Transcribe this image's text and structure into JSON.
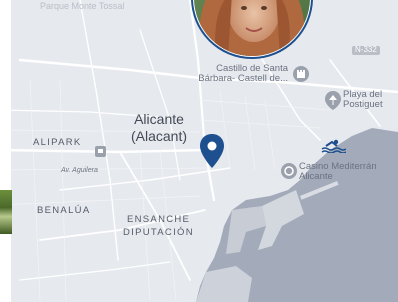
{
  "map": {
    "city": {
      "name": "Alicante",
      "local_name": "(Alacant)"
    },
    "districts": [
      "ALIPARK",
      "BENALÚA",
      "ENSANCHE",
      "DIPUTACIÓN"
    ],
    "streets": [
      "Av. Aguilera"
    ],
    "top_label": "Parque Monte Tossal",
    "highway_badge": "N-332",
    "pois": {
      "castle": {
        "line1": "Castillo de Santa",
        "line2": "Bárbara- Castell de..."
      },
      "beach": {
        "line1": "Playa del",
        "line2": "Postiguet"
      },
      "casino": {
        "line1": "Casino Mediterrán",
        "line2": "Alicante"
      }
    },
    "colors": {
      "land": "#e6e9ee",
      "water": "#a3abba",
      "pin": "#1e4f8f",
      "avatar_ring": "#1e4f8f"
    },
    "icons": {
      "location_pin": "location-pin-icon",
      "castle": "landmark-icon",
      "beach": "beach-icon",
      "swim": "swimming-icon",
      "casino": "casino-icon",
      "transit": "transit-stop-icon"
    }
  }
}
